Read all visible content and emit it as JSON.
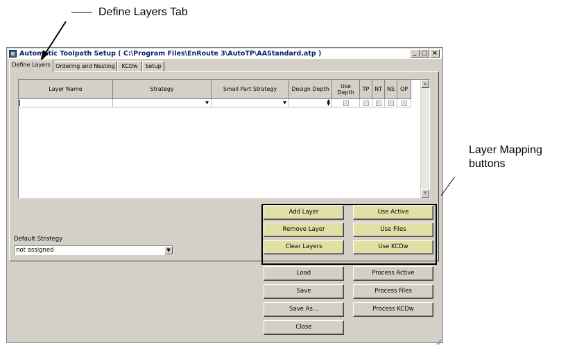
{
  "annotations": {
    "define_layers_tab": "Define Layers Tab",
    "layer_mapping_buttons_line1": "Layer Mapping",
    "layer_mapping_buttons_line2": "buttons"
  },
  "window": {
    "title": "Automatic Toolpath Setup ( C:\\Program Files\\EnRoute 3\\AutoTP\\AAStandard.atp )",
    "caption_buttons": [
      "_",
      "□",
      "×"
    ]
  },
  "tabs": [
    {
      "label": "Define Layers",
      "active": true
    },
    {
      "label": "Ordering and Nesting",
      "active": false
    },
    {
      "label": "KCDw",
      "active": false
    },
    {
      "label": "Setup",
      "active": false
    }
  ],
  "grid": {
    "columns": [
      "Layer Name",
      "Strategy",
      "Small Part Strategy",
      "Design Depth",
      "Use Depth",
      "TP",
      "NT",
      "NS",
      "OP"
    ],
    "row": {
      "layer_name": "",
      "strategy": "",
      "small_part_strategy": "",
      "design_depth": "",
      "use_depth": true,
      "tp": true,
      "nt": true,
      "ns": true,
      "op": true
    }
  },
  "default_strategy": {
    "label": "Default Strategy",
    "value": "not assigned"
  },
  "layer_mapping_buttons": {
    "add_layer": "Add Layer",
    "remove_layer": "Remove Layer",
    "clear_layers": "Clear Layers",
    "use_active": "Use Active",
    "use_files": "Use Files",
    "use_kcdw": "Use KCDw"
  },
  "file_buttons": {
    "load": "Load",
    "save": "Save",
    "save_as": "Save As...",
    "close": "Close",
    "process_active": "Process Active",
    "process_files": "Process Files",
    "process_kcdw": "Process KCDw"
  },
  "colors": {
    "dialog_face": "#d4d0c8",
    "title_text": "#0a246a",
    "mapping_button": "#e1dfa6"
  }
}
